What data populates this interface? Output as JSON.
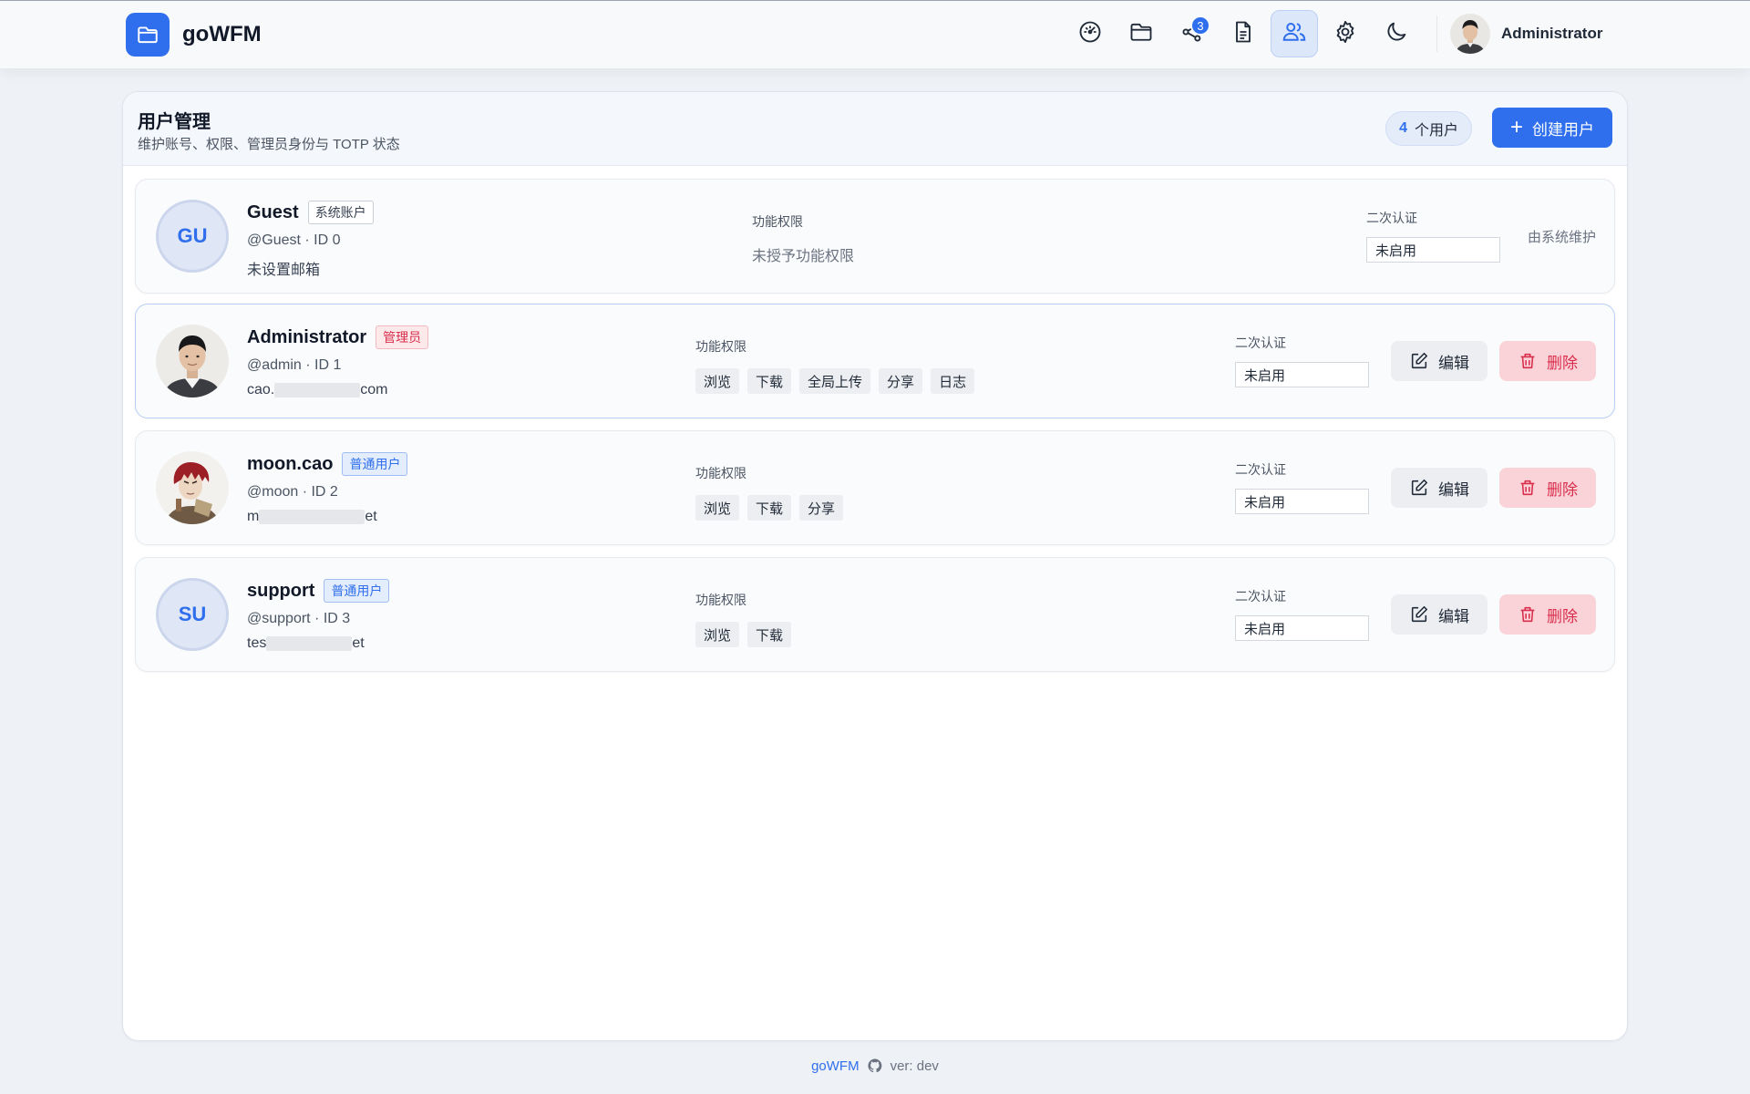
{
  "app": {
    "name": "goWFM"
  },
  "nav": {
    "items": [
      {
        "icon": "dashboard-gauge-icon"
      },
      {
        "icon": "folder-icon"
      },
      {
        "icon": "share-icon",
        "badge": "3"
      },
      {
        "icon": "document-icon"
      },
      {
        "icon": "users-icon",
        "active": true
      },
      {
        "icon": "gear-icon"
      },
      {
        "icon": "moon-icon"
      }
    ],
    "user_name": "Administrator"
  },
  "page": {
    "title": "用户管理",
    "subtitle": "维护账号、权限、管理员身份与 TOTP 状态",
    "count_number": "4",
    "count_suffix": "个用户",
    "create_label": "创建用户"
  },
  "labels": {
    "perm_header": "功能权限",
    "totp_header": "二次认证",
    "edit": "编辑",
    "delete": "删除",
    "maintained_by_system": "由系统维护",
    "no_permission": "未授予功能权限"
  },
  "users": [
    {
      "initials": "GU",
      "name": "Guest",
      "role_tag": "系统账户",
      "handle": "@Guest · ID 0",
      "email": "未设置邮箱",
      "permissions": [],
      "totp": "未启用"
    },
    {
      "name": "Administrator",
      "role_tag": "管理员",
      "handle": "@admin · ID 1",
      "email_prefix": "cao.",
      "email_suffix": "com",
      "permissions": [
        "浏览",
        "下载",
        "全局上传",
        "分享",
        "日志"
      ],
      "totp": "未启用"
    },
    {
      "name": "moon.cao",
      "role_tag": "普通用户",
      "handle": "@moon · ID 2",
      "email_prefix": "m",
      "email_suffix": "et",
      "permissions": [
        "浏览",
        "下载",
        "分享"
      ],
      "totp": "未启用"
    },
    {
      "initials": "SU",
      "name": "support",
      "role_tag": "普通用户",
      "handle": "@support · ID 3",
      "email_prefix": "tes",
      "email_suffix": "et",
      "permissions": [
        "浏览",
        "下载"
      ],
      "totp": "未启用"
    }
  ],
  "footer": {
    "name": "goWFM",
    "version": "ver: dev"
  },
  "colors": {
    "accent": "#2f6fed",
    "danger": "#d92d4c",
    "background": "#eef1f5"
  }
}
